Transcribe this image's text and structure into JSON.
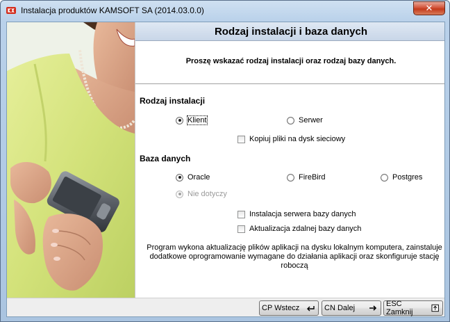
{
  "window": {
    "title": "Instalacja produktów KAMSOFT SA (2014.03.0.0)",
    "close_glyph": "✕"
  },
  "header": {
    "title": "Rodzaj instalacji i baza danych",
    "subtitle": "Proszę wskazać rodzaj instalacji oraz rodzaj bazy danych."
  },
  "install_type": {
    "label": "Rodzaj instalacji",
    "options": [
      {
        "label": "Klient",
        "selected": true
      },
      {
        "label": "Serwer",
        "selected": false
      }
    ],
    "copy_files": {
      "label": "Kopiuj pliki na dysk sieciowy",
      "checked": false
    }
  },
  "database": {
    "label": "Baza danych",
    "options": [
      {
        "label": "Oracle",
        "selected": true
      },
      {
        "label": "FireBird",
        "selected": false
      },
      {
        "label": "Postgres",
        "selected": false
      },
      {
        "label": "Nie dotyczy",
        "selected": true,
        "disabled": true
      }
    ],
    "server_install": {
      "label": "Instalacja serwera bazy danych",
      "checked": false
    },
    "remote_update": {
      "label": "Aktualizacja zdalnej bazy danych",
      "checked": false
    }
  },
  "description": "Program wykona aktualizację plików aplikacji na dysku lokalnym komputera, zainstaluje dodatkowe oprogramowanie wymagane do działania aplikacji oraz skonfiguruje stację roboczą",
  "footer": {
    "back_label": "CP Wstecz",
    "next_label": "CN Dalej",
    "close_label": "ESC Zamknij",
    "back_icon": "back-arrow-icon",
    "next_icon": "next-arrow-icon",
    "close_icon": "exit-door-icon"
  },
  "colors": {
    "header_bar": "#c8d6e8",
    "photo_top": "#f3f6ee"
  }
}
